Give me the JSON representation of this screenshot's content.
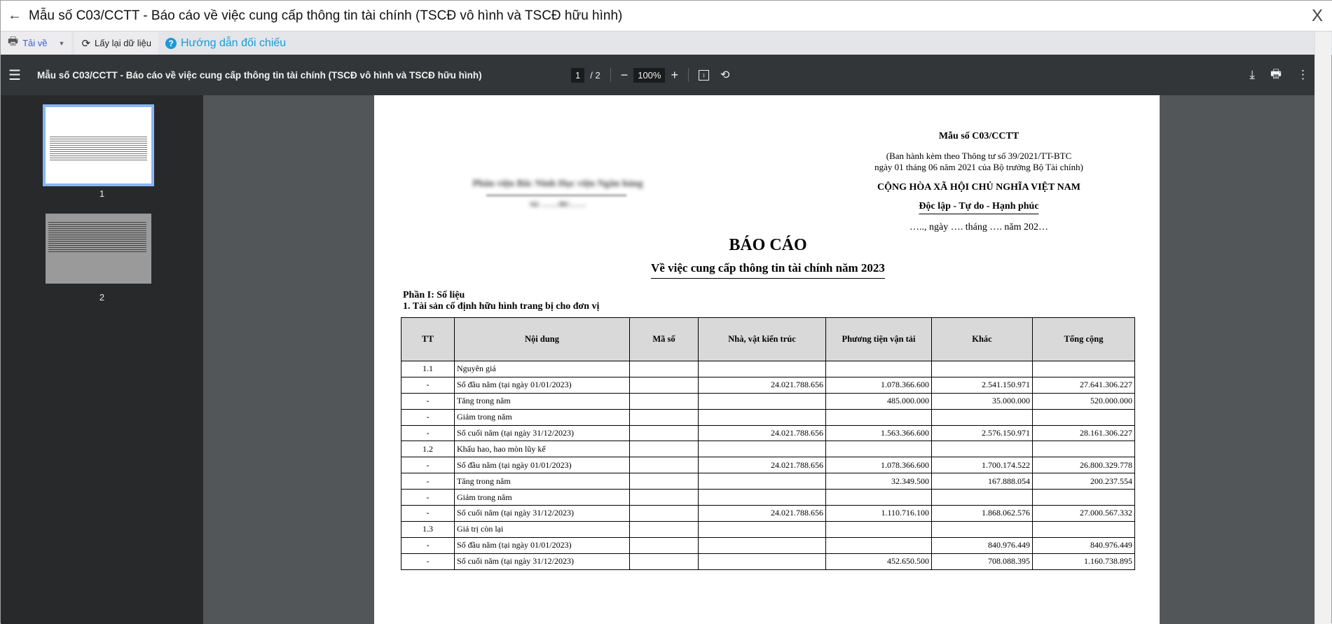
{
  "window": {
    "title": "Mẫu số C03/CCTT - Báo cáo về việc cung cấp thông tin tài chính (TSCĐ vô hình và TSCĐ hữu hình)",
    "close": "X",
    "back": "←"
  },
  "toolbar": {
    "download": "Tải về",
    "refresh": "Lấy lại dữ liệu",
    "guide": "Hướng dẫn đối chiếu"
  },
  "pdf": {
    "title": "Mẫu số C03/CCTT - Báo cáo về việc cung cấp thông tin tài chính (TSCĐ vô hình và TSCĐ hữu hình)",
    "page": "1",
    "pages": "/  2",
    "zoom": "100%",
    "thumbs": [
      "1",
      "2"
    ]
  },
  "doc": {
    "form_no": "Mẫu số C03/CCTT",
    "issued1": "(Ban hành kèm theo Thông tư số 39/2021/TT-BTC",
    "issued2": "ngày 01 tháng 06 năm 2021 của Bộ trưởng Bộ Tài chính)",
    "nation": "CỘNG HÒA XÃ HỘI CHỦ NGHĨA VIỆT NAM",
    "motto": "Độc lập - Tự do - Hạnh phúc",
    "date": "….., ngày …. tháng …. năm 202…",
    "org": "Phân viện Bắc Ninh Học viện Ngân hàng",
    "org_no": "Số: ……/BC……",
    "heading": "BÁO CÁO",
    "subheading": "Về việc cung cấp thông tin tài chính năm 2023",
    "part": "Phần I: Số liệu",
    "section": "1. Tài sản cố định hữu hình trang bị cho đơn vị",
    "columns": [
      "TT",
      "Nội dung",
      "Mã số",
      "Nhà, vật kiến trúc",
      "Phương tiện vận tải",
      "Khác",
      "Tổng cộng"
    ],
    "rows": [
      [
        "1.1",
        "Nguyên giá",
        "",
        "",
        "",
        "",
        ""
      ],
      [
        "-",
        "Số đầu năm (tại ngày 01/01/2023)",
        "",
        "24.021.788.656",
        "1.078.366.600",
        "2.541.150.971",
        "27.641.306.227"
      ],
      [
        "-",
        "Tăng trong năm",
        "",
        "",
        "485.000.000",
        "35.000.000",
        "520.000.000"
      ],
      [
        "-",
        "Giảm trong năm",
        "",
        "",
        "",
        "",
        ""
      ],
      [
        "-",
        "Số cuối năm (tại ngày 31/12/2023)",
        "",
        "24.021.788.656",
        "1.563.366.600",
        "2.576.150.971",
        "28.161.306.227"
      ],
      [
        "1.2",
        "Khấu hao, hao mòn lũy kế",
        "",
        "",
        "",
        "",
        ""
      ],
      [
        "-",
        "Số đầu năm (tại ngày 01/01/2023)",
        "",
        "24.021.788.656",
        "1.078.366.600",
        "1.700.174.522",
        "26.800.329.778"
      ],
      [
        "-",
        "Tăng trong năm",
        "",
        "",
        "32.349.500",
        "167.888.054",
        "200.237.554"
      ],
      [
        "-",
        "Giảm trong năm",
        "",
        "",
        "",
        "",
        ""
      ],
      [
        "-",
        "Số cuối năm (tại ngày 31/12/2023)",
        "",
        "24.021.788.656",
        "1.110.716.100",
        "1.868.062.576",
        "27.000.567.332"
      ],
      [
        "1.3",
        "Giá trị còn lại",
        "",
        "",
        "",
        "",
        ""
      ],
      [
        "-",
        "Số đầu năm (tại ngày 01/01/2023)",
        "",
        "",
        "",
        "840.976.449",
        "840.976.449"
      ],
      [
        "-",
        "Số cuối năm (tại ngày 31/12/2023)",
        "",
        "",
        "452.650.500",
        "708.088.395",
        "1.160.738.895"
      ]
    ]
  }
}
